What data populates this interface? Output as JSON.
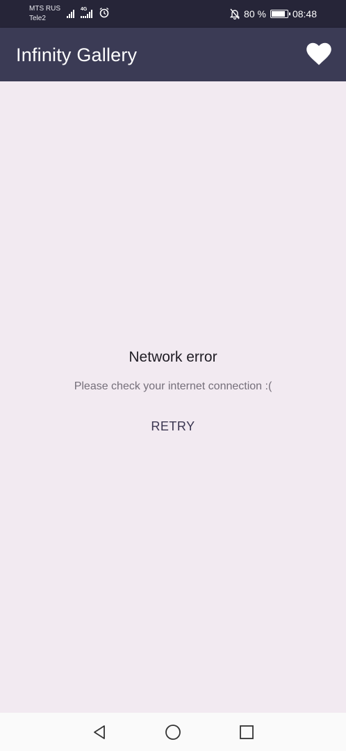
{
  "status_bar": {
    "carrier_1": "MTS RUS",
    "carrier_2": "Tele2",
    "network_label": "4G",
    "battery_percent": "80 %",
    "battery_level": 0.8,
    "time": "08:48"
  },
  "app_bar": {
    "title": "Infinity Gallery",
    "favorites_icon": "heart-icon"
  },
  "error": {
    "title": "Network error",
    "message": "Please check your internet connection :(",
    "retry_label": "RETRY"
  },
  "nav_bar": {
    "back_icon": "triangle-back-icon",
    "home_icon": "circle-home-icon",
    "recents_icon": "square-recents-icon"
  },
  "colors": {
    "status_bar": "#262538",
    "app_bar": "#3b3b55",
    "background": "#f2eaf1",
    "nav_bar": "#fafafa"
  }
}
